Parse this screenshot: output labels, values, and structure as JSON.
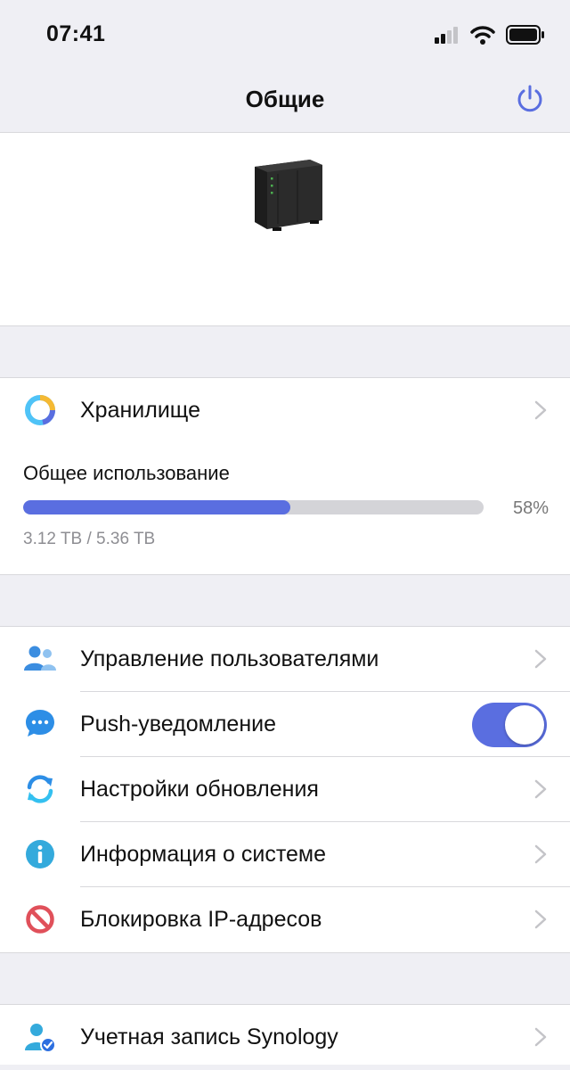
{
  "status_bar": {
    "time": "07:41"
  },
  "nav": {
    "title": "Общие"
  },
  "storage": {
    "label": "Хранилище",
    "usage_title": "Общее использование",
    "usage_fraction": 0.58,
    "usage_percent_text": "58%",
    "usage_amount": "3.12 TB / 5.36 TB"
  },
  "menu": {
    "items": [
      {
        "label": "Управление пользователями"
      },
      {
        "label": "Push-уведомление",
        "toggle_on": true
      },
      {
        "label": "Настройки обновления"
      },
      {
        "label": "Информация о системе"
      },
      {
        "label": "Блокировка IP-адресов"
      }
    ]
  },
  "account": {
    "label": "Учетная запись Synology"
  },
  "colors": {
    "accent": "#5a6ee0",
    "info": "#34aadc",
    "block": "#e0505a"
  }
}
